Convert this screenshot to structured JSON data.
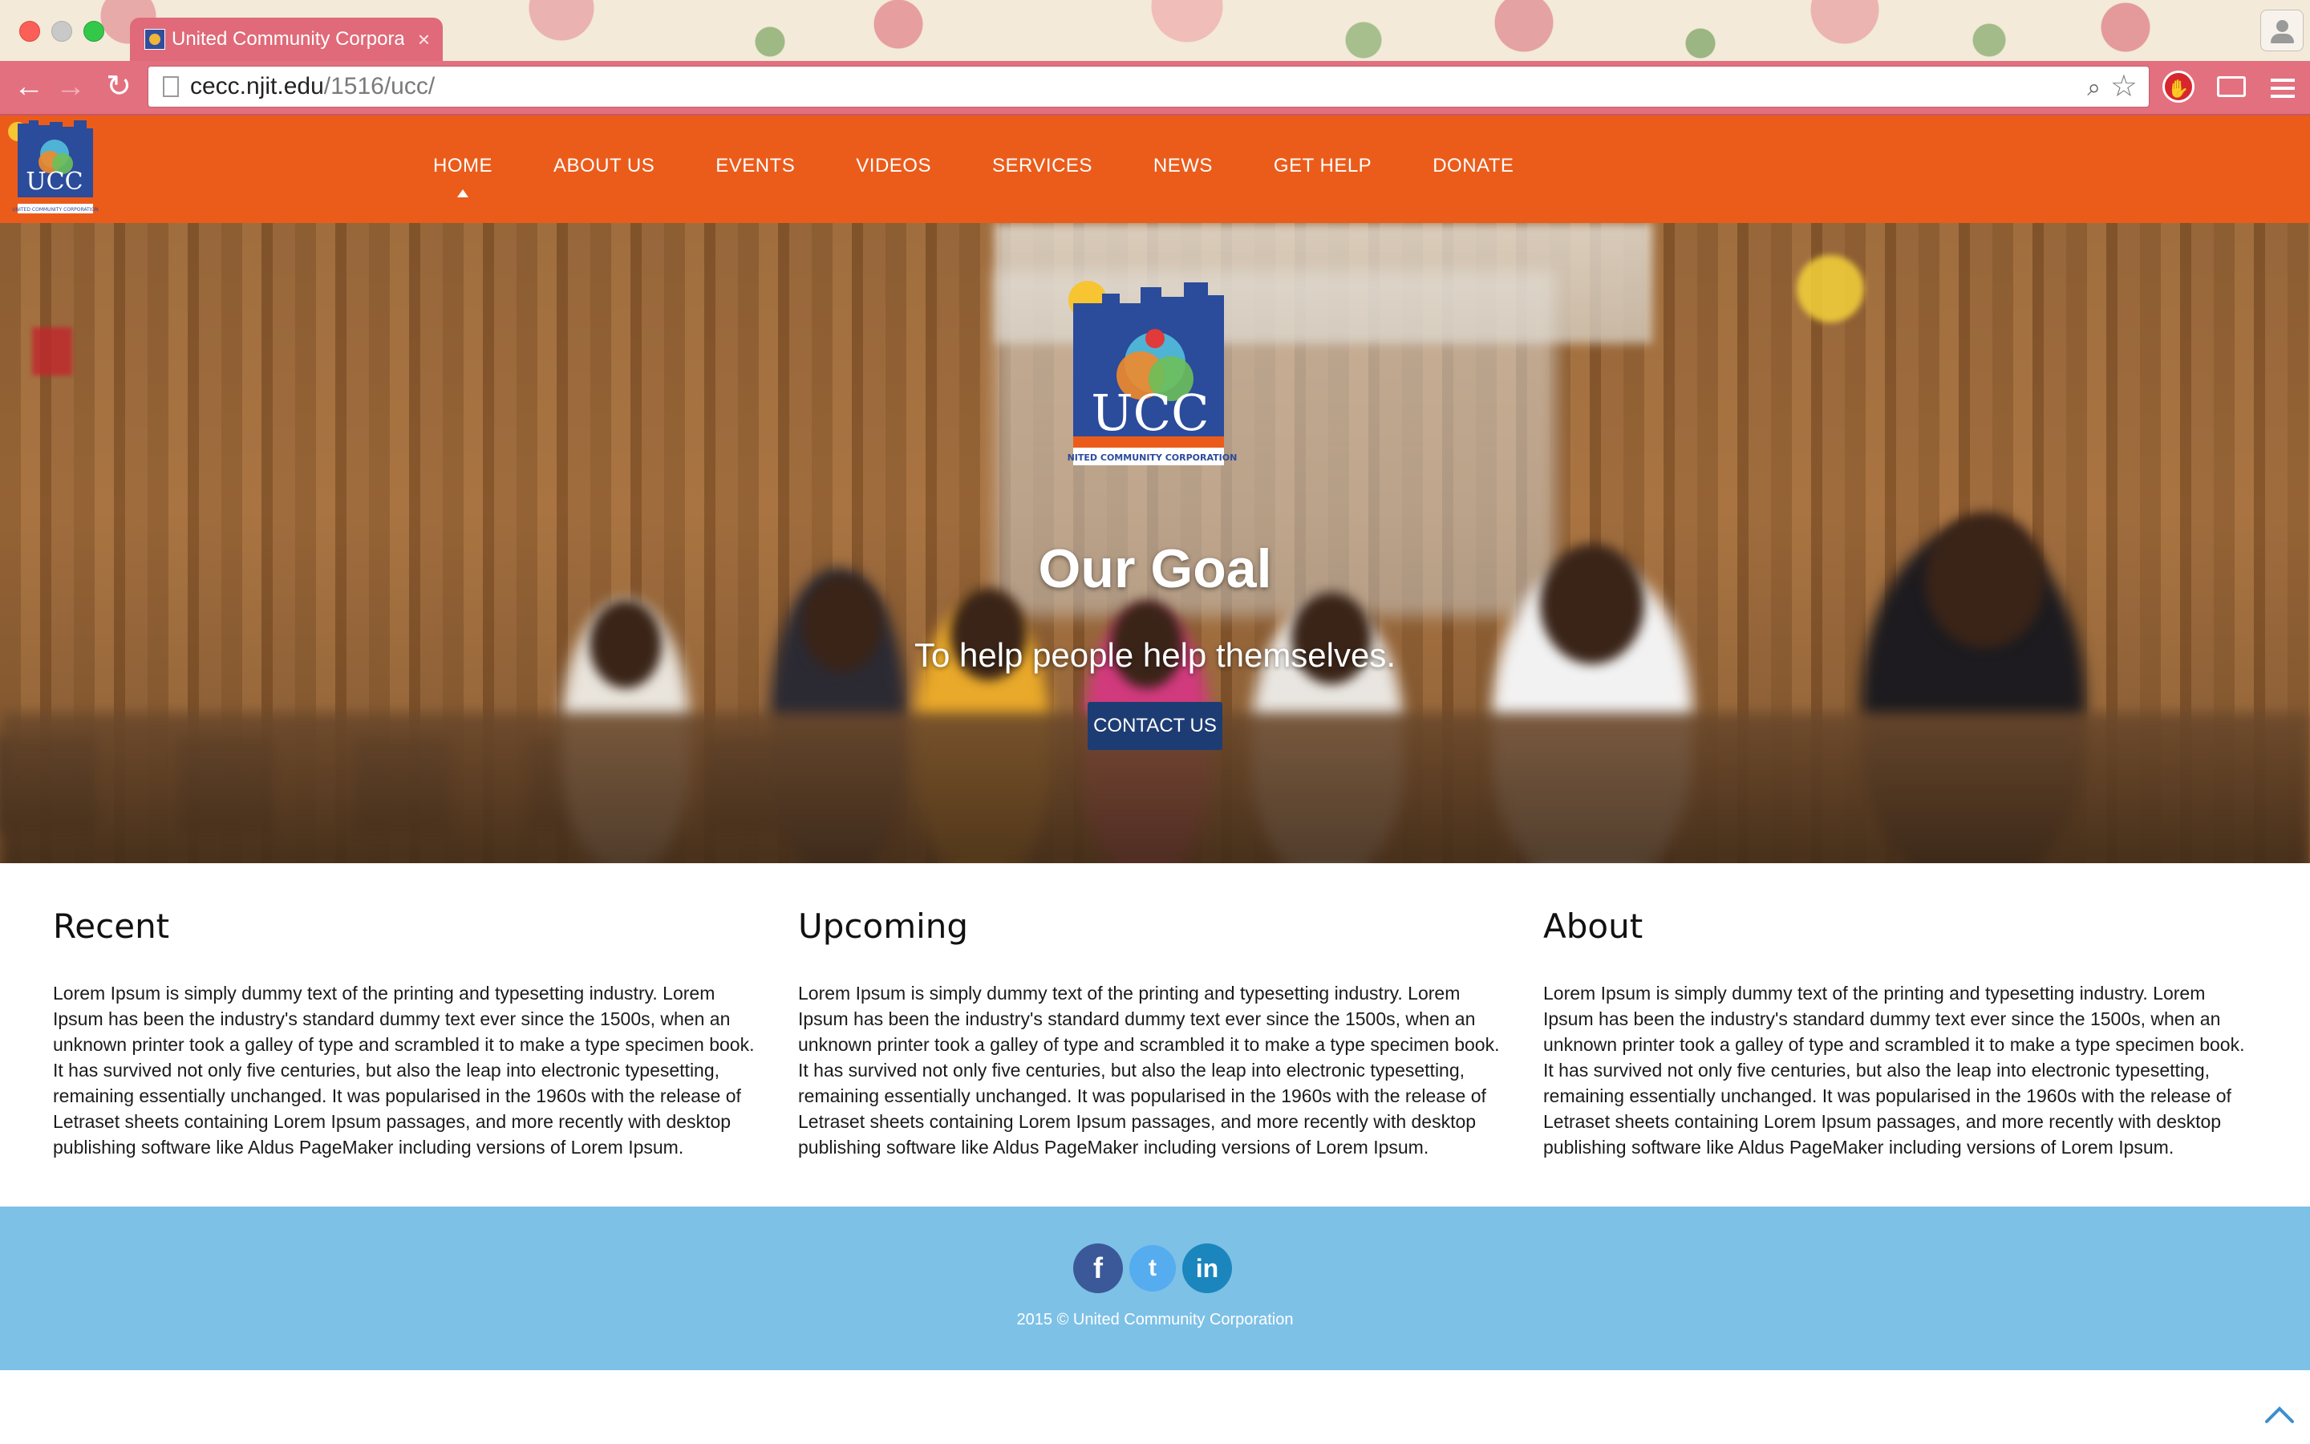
{
  "browser": {
    "tab_title": "United Community Corporation",
    "tab_close": "×",
    "url_host": "cecc.njit.edu",
    "url_path": "/1516/ucc/",
    "back_glyph": "←",
    "forward_glyph": "→",
    "reload_glyph": "↻",
    "search_glyph": "⌕",
    "star_glyph": "☆",
    "icons": [
      "back-arrow-icon",
      "forward-arrow-icon",
      "reload-icon",
      "page-icon",
      "search-icon",
      "star-icon",
      "adblock-icon",
      "cast-icon",
      "menu-icon",
      "profile-icon"
    ]
  },
  "site": {
    "logo_alt": "UCC United Community Corporation",
    "nav": [
      {
        "label": "HOME",
        "active": true
      },
      {
        "label": "ABOUT US"
      },
      {
        "label": "EVENTS"
      },
      {
        "label": "VIDEOS"
      },
      {
        "label": "SERVICES"
      },
      {
        "label": "NEWS"
      },
      {
        "label": "GET HELP"
      },
      {
        "label": "DONATE"
      }
    ],
    "accent_color": "#eb5c1b"
  },
  "hero": {
    "logo_text": "UCC",
    "logo_caption": "UNITED COMMUNITY CORPORATION",
    "title": "Our Goal",
    "subtitle": "To help people help themselves.",
    "cta_label": "CONTACT US",
    "cta_color": "#1d3c74"
  },
  "columns": [
    {
      "heading": "Recent",
      "body": "Lorem Ipsum is simply dummy text of the printing and typesetting industry. Lorem Ipsum has been the industry's standard dummy text ever since the 1500s, when an unknown printer took a galley of type and scrambled it to make a type specimen book. It has survived not only five centuries, but also the leap into electronic typesetting, remaining essentially unchanged. It was popularised in the 1960s with the release of Letraset sheets containing Lorem Ipsum passages, and more recently with desktop publishing software like Aldus PageMaker including versions of Lorem Ipsum."
    },
    {
      "heading": "Upcoming",
      "body": "Lorem Ipsum is simply dummy text of the printing and typesetting industry. Lorem Ipsum has been the industry's standard dummy text ever since the 1500s, when an unknown printer took a galley of type and scrambled it to make a type specimen book. It has survived not only five centuries, but also the leap into electronic typesetting, remaining essentially unchanged. It was popularised in the 1960s with the release of Letraset sheets containing Lorem Ipsum passages, and more recently with desktop publishing software like Aldus PageMaker including versions of Lorem Ipsum."
    },
    {
      "heading": "About",
      "body": "Lorem Ipsum is simply dummy text of the printing and typesetting industry. Lorem Ipsum has been the industry's standard dummy text ever since the 1500s, when an unknown printer took a galley of type and scrambled it to make a type specimen book. It has survived not only five centuries, but also the leap into electronic typesetting, remaining essentially unchanged. It was popularised in the 1960s with the release of Letraset sheets containing Lorem Ipsum passages, and more recently with desktop publishing software like Aldus PageMaker including versions of Lorem Ipsum."
    }
  ],
  "footer": {
    "social": [
      {
        "name": "facebook-icon",
        "glyph": "f",
        "color": "#3b5998"
      },
      {
        "name": "twitter-icon",
        "glyph": "t",
        "color": "#55acee"
      },
      {
        "name": "linkedin-icon",
        "glyph": "in",
        "color": "#1b86bd"
      }
    ],
    "copyright": "2015 © United Community Corporation",
    "background": "#7dc1e6"
  }
}
